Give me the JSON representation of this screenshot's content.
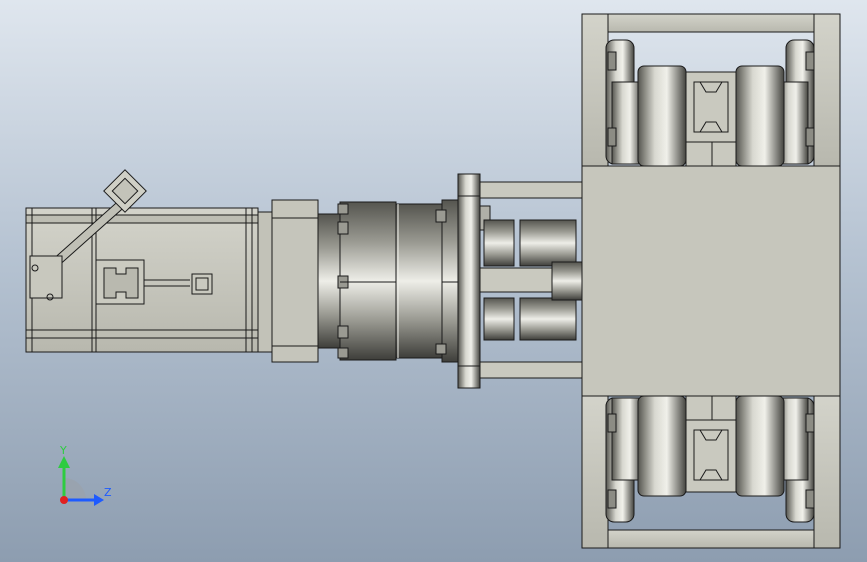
{
  "triad": {
    "y_label": "Y",
    "z_label": "Z",
    "y_color": "#2ecc40",
    "z_color": "#1e5bff",
    "x_color": "#e02020"
  },
  "colors": {
    "part_fill": "#c7c7bd",
    "part_stroke": "#1a1a1a",
    "cylinder_dark": "#4a4a44",
    "cylinder_light": "#f2f2ec",
    "background_top": "#dfe6ee",
    "background_bottom": "#8d9db0"
  },
  "icons": [
    "triad-icon"
  ]
}
